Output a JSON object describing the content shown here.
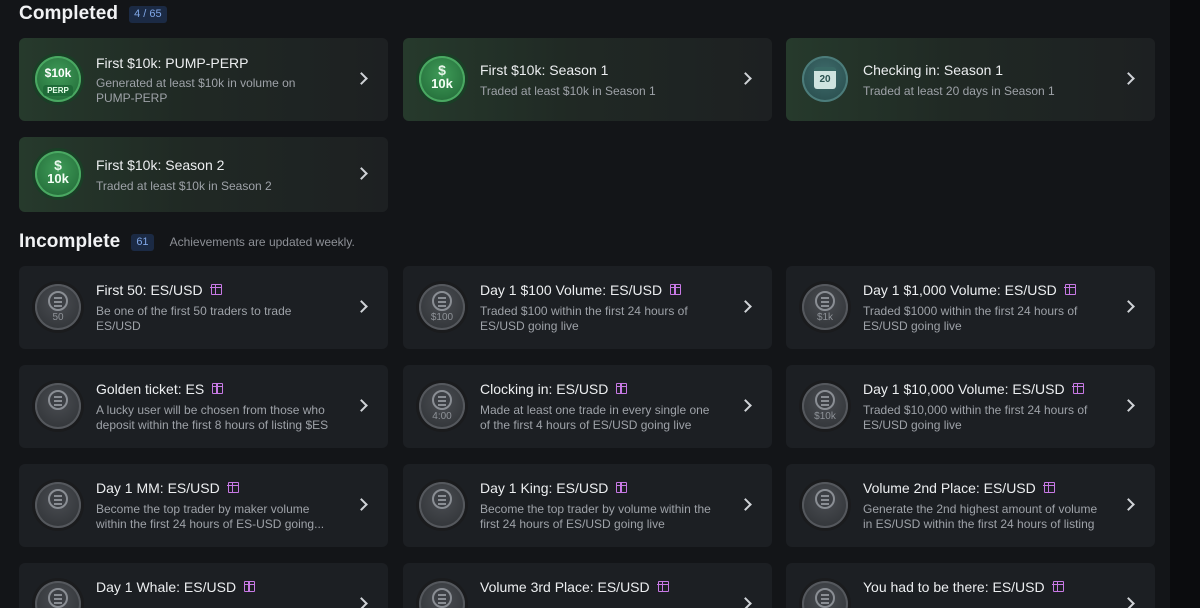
{
  "completed": {
    "title": "Completed",
    "count": "4 / 65",
    "cards": [
      {
        "title": "First $10k: PUMP-PERP",
        "desc": "Generated at least $10k in volume on PUMP-PERP",
        "badge_top": "$10k",
        "badge_pill": "PERP",
        "icon": "pump-perp-badge-icon"
      },
      {
        "title": "First $10k: Season 1",
        "desc": "Traded at least $10k in Season 1",
        "badge_sym": "$",
        "badge_main": "10k",
        "icon": "dollar-10k-badge-icon"
      },
      {
        "title": "Checking in: Season 1",
        "desc": "Traded at least 20 days in Season 1",
        "badge_cal": "20",
        "icon": "calendar-badge-icon"
      },
      {
        "title": "First $10k: Season 2",
        "desc": "Traded at least $10k in Season 2",
        "badge_sym": "$",
        "badge_main": "10k",
        "icon": "dollar-10k-badge-icon"
      }
    ]
  },
  "incomplete": {
    "title": "Incomplete",
    "count": "61",
    "note": "Achievements are updated weekly.",
    "cards": [
      {
        "title": "First 50: ES/USD",
        "desc": "Be one of the first 50 traders to trade ES/USD",
        "badge_label": "50"
      },
      {
        "title": "Day 1 $100 Volume: ES/USD",
        "desc": "Traded $100 within the first 24 hours of ES/USD going live",
        "badge_label": "$100"
      },
      {
        "title": "Day 1 $1,000 Volume: ES/USD",
        "desc": "Traded $1000 within the first 24 hours of ES/USD going live",
        "badge_label": "$1k"
      },
      {
        "title": "Golden ticket: ES",
        "desc": "A lucky user will be chosen from those who deposit within the first 8 hours of listing $ES",
        "badge_label": ""
      },
      {
        "title": "Clocking in: ES/USD",
        "desc": "Made at least one trade in every single one of the first 4 hours of ES/USD going live",
        "badge_label": "4:00"
      },
      {
        "title": "Day 1 $10,000 Volume: ES/USD",
        "desc": "Traded $10,000 within the first 24 hours of ES/USD going live",
        "badge_label": "$10k"
      },
      {
        "title": "Day 1 MM: ES/USD",
        "desc": "Become the top trader by maker volume within the first 24 hours of ES-USD going...",
        "badge_label": ""
      },
      {
        "title": "Day 1 King: ES/USD",
        "desc": "Become the top trader by volume within the first 24 hours of ES/USD going live",
        "badge_label": ""
      },
      {
        "title": "Volume 2nd Place: ES/USD",
        "desc": "Generate the 2nd highest amount of volume in ES/USD within the first 24 hours of listing",
        "badge_label": ""
      },
      {
        "title": "Day 1 Whale: ES/USD",
        "desc": "",
        "badge_label": ""
      },
      {
        "title": "Volume 3rd Place: ES/USD",
        "desc": "",
        "badge_label": ""
      },
      {
        "title": "You had to be there: ES/USD",
        "desc": "",
        "badge_label": ""
      }
    ]
  },
  "colors": {
    "gift": "#c779e4",
    "completed_bg": "#263a2c",
    "badge_count": "#7fa6e6"
  }
}
